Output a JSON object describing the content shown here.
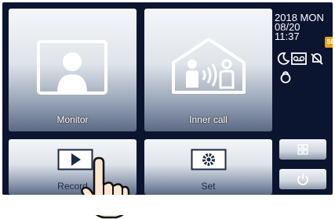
{
  "status": {
    "year_day": "2018  MON",
    "date": "08/20",
    "time": "11:37",
    "sd_badge": "SD"
  },
  "tiles": {
    "monitor_label": "Monitor",
    "inner_call_label": "Inner call",
    "record_label": "Record",
    "set_label": "Set"
  },
  "icons": {
    "monitor": "person-in-frame",
    "inner_call": "house-with-people",
    "record": "play-button",
    "set": "gear",
    "night_mode": "crescent-moon",
    "voicemail": "tape",
    "mute": "bell-slash",
    "lock": "padlock-ring",
    "grid": "four-squares",
    "power": "power"
  },
  "colors": {
    "background": "#0b1530",
    "sd_badge": "#e8a21b"
  }
}
